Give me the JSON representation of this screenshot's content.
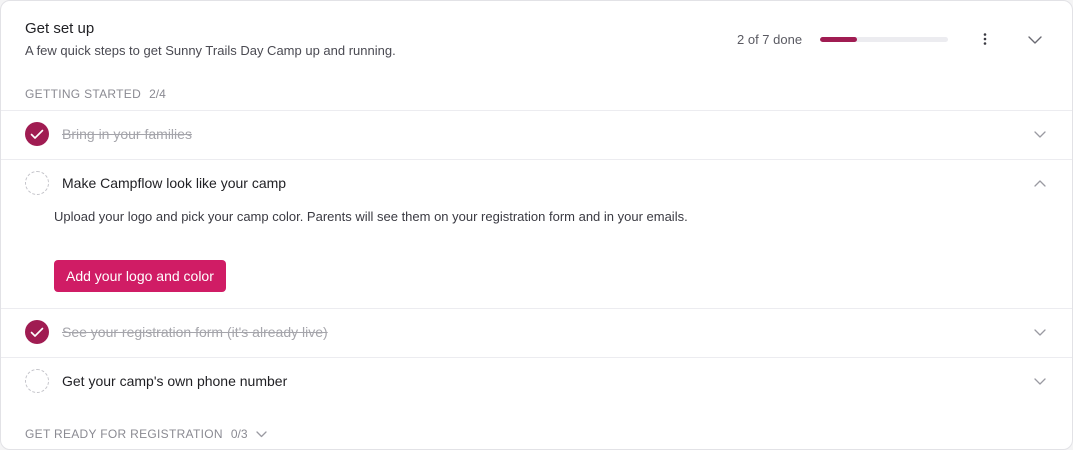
{
  "colors": {
    "brand": "#a01c52",
    "cta": "#d01c65",
    "muted": "#8a8a92",
    "done_text": "#a5a5ab"
  },
  "header": {
    "title": "Get set up",
    "subtitle": "A few quick steps to get Sunny Trails Day Camp up and running.",
    "progress_text": "2 of 7 done",
    "progress": {
      "done": 2,
      "total": 7
    },
    "menu_icon": "kebab-menu-icon",
    "collapse_icon": "chevron-down-icon"
  },
  "sections": [
    {
      "label": "GETTING STARTED",
      "count": "2/4",
      "items": [
        {
          "label": "Bring in your families",
          "done": true,
          "expanded": false
        },
        {
          "label": "Make Campflow look like your camp",
          "done": false,
          "expanded": true,
          "description": "Upload your logo and pick your camp color. Parents will see them on your registration form and in your emails.",
          "cta_label": "Add your logo and color"
        },
        {
          "label": "See your registration form (it's already live)",
          "done": true,
          "expanded": false
        },
        {
          "label": "Get your camp's own phone number",
          "done": false,
          "expanded": false
        }
      ]
    },
    {
      "label": "GET READY FOR REGISTRATION",
      "count": "0/3",
      "collapsed": true
    }
  ]
}
